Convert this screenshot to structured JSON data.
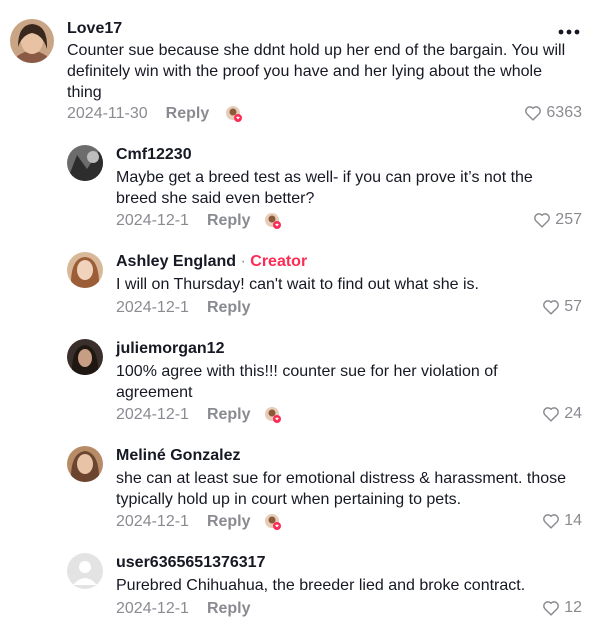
{
  "comments": [
    {
      "username": "Love17",
      "text": "Counter sue because she ddnt hold up her end of the bargain. You will definitely win with the proof you have and her lying about the whole thing",
      "date": "2024-11-30",
      "reply_label": "Reply",
      "likes": "6363"
    },
    {
      "username": "Cmf12230",
      "text": "Maybe get a breed test as well- if you can prove it’s not the breed she said even better?",
      "date": "2024-12-1",
      "reply_label": "Reply",
      "likes": "257"
    },
    {
      "username": "Ashley England",
      "creator_dot": "·",
      "creator_label": "Creator",
      "text": "I will on Thursday! can't wait to find out what she is.",
      "date": "2024-12-1",
      "reply_label": "Reply",
      "likes": "57"
    },
    {
      "username": "juliemorgan12",
      "text": "100% agree with this!!! counter sue for her violation of agreement",
      "date": "2024-12-1",
      "reply_label": "Reply",
      "likes": "24"
    },
    {
      "username": "Meliné Gonzalez",
      "text": "she can at least sue for emotional distress & harassment. those typically hold up in court when pertaining to pets.",
      "date": "2024-12-1",
      "reply_label": "Reply",
      "likes": "14"
    },
    {
      "username": "user6365651376317",
      "text": "Purebred Chihuahua, the breeder lied and broke contract.",
      "date": "2024-12-1",
      "reply_label": "Reply",
      "likes": "12"
    }
  ],
  "colors": {
    "text": "#161823",
    "muted": "#8a8b91",
    "accent": "#fe2c55"
  },
  "icons": {
    "more": "more-horizontal-icon",
    "like": "heart-outline-icon",
    "creator_liked": "creator-liked-avatar-icon"
  }
}
